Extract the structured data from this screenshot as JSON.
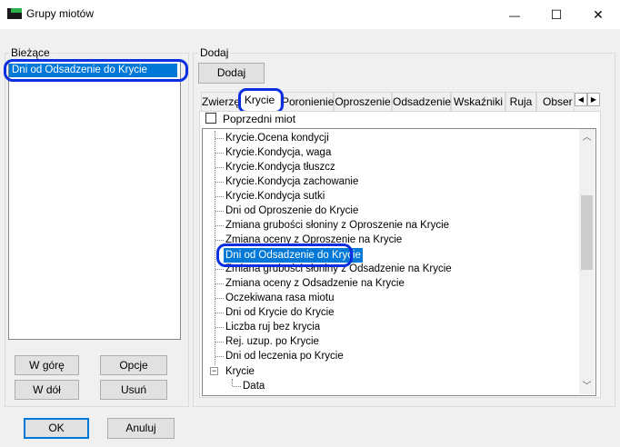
{
  "window": {
    "title": "Grupy miotów",
    "minimize": "—",
    "maximize": "☐",
    "close": "✕"
  },
  "left": {
    "label": "Bieżące",
    "items": [
      "Dni od Odsadzenie do Krycie"
    ],
    "buttons": {
      "up": "W górę",
      "options": "Opcje",
      "down": "W dół",
      "delete": "Usuń"
    }
  },
  "right": {
    "label": "Dodaj",
    "add_button": "Dodaj",
    "tabs": [
      "Zwierzę",
      "Krycie",
      "Poronienie",
      "Oproszenie",
      "Odsadzenie",
      "Wskaźniki",
      "Ruja",
      "Obser"
    ],
    "active_tab": "Krycie",
    "checkbox_label": "Poprzedni miot",
    "tree": [
      "Krycie.Ocena kondycji",
      "Krycie.Kondycja, waga",
      "Krycie.Kondycja tłuszcz",
      "Krycie.Kondycja zachowanie",
      "Krycie.Kondycja sutki",
      "Dni od Oproszenie do Krycie",
      "Zmiana grubości słoniny z Oproszenie na Krycie",
      "Zmiana oceny z Oproszenie na Krycie",
      "Dni od Odsadzenie do Krycie",
      "Zmiana grubości słoniny z Odsadzenie na Krycie",
      "Zmiana oceny z Odsadzenie na Krycie",
      "Oczekiwana rasa miotu",
      "Dni od Krycie do Krycie",
      "Liczba ruj bez krycia",
      "Rej. uzup. po Krycie",
      "Dni od leczenia po Krycie"
    ],
    "tree_group": {
      "label": "Krycie",
      "toggle": "−",
      "child": "Data"
    }
  },
  "footer": {
    "ok": "OK",
    "cancel": "Anuluj"
  },
  "colors": {
    "selection": "#0078d7",
    "highlight_ring": "#0a2fe0"
  }
}
